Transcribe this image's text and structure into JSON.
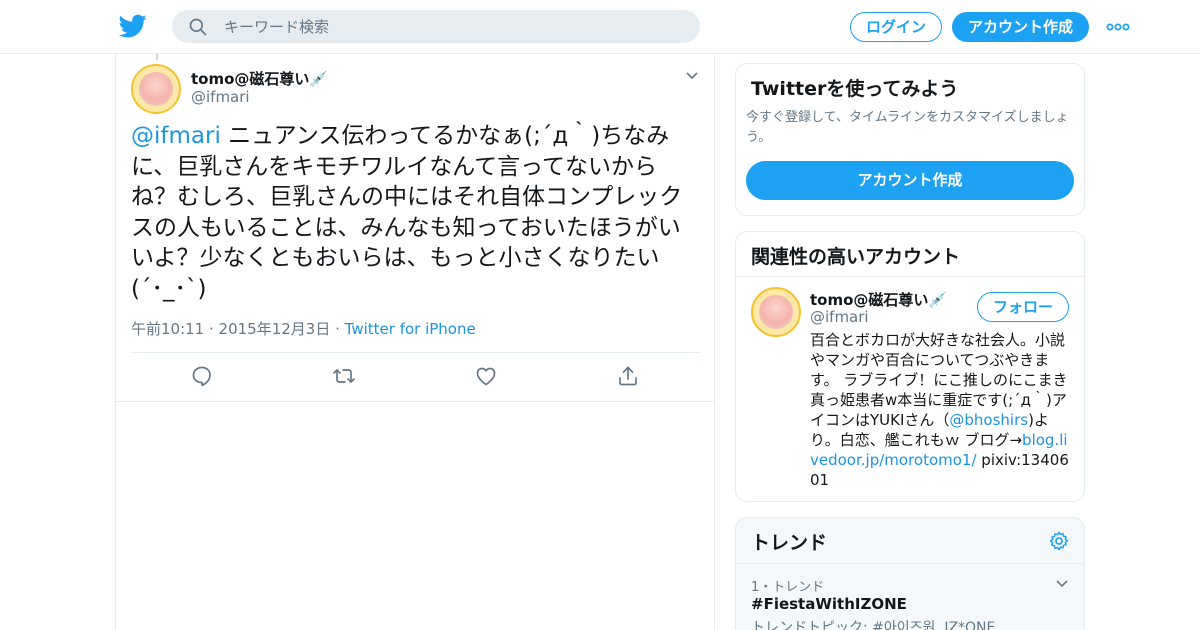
{
  "header": {
    "search_placeholder": "キーワード検索",
    "login_label": "ログイン",
    "signup_label": "アカウント作成",
    "brand_color": "#1da1f2"
  },
  "tweet": {
    "author_name": "tomo@磁石尊い💉",
    "author_handle": "@ifmari",
    "mention": "@ifmari",
    "text": " ニュアンス伝わってるかなぁ(;´д｀)ちなみに、巨乳さんをキモチワルイなんて言ってないからね？むしろ、巨乳さんの中にはそれ自体コンプレックスの人もいることは、みんなも知っておいたほうがいいよ？少なくともおいらは、もっと小さくなりたい(´･_･`)",
    "timestamp": "午前10:11 · 2015年12月3日",
    "separator": " · ",
    "source": "Twitter for iPhone"
  },
  "signup_card": {
    "title": "Twitterを使ってみよう",
    "description": "今すぐ登録して、タイムラインをカスタマイズしましょう。",
    "button_label": "アカウント作成"
  },
  "related": {
    "title": "関連性の高いアカウント",
    "name": "tomo@磁石尊い💉",
    "handle": "@ifmari",
    "follow_label": "フォロー",
    "bio_part1": "百合とボカロが大好きな社会人。小説やマンガや百合についてつぶやきます。 ラブライブ！にこ推しのにこまき真っ姫患者w本当に重症です(;´д｀)アイコンはYUKIさん（",
    "bio_link1": "@bhoshirs",
    "bio_part2": ")より。白恋、艦これもｗ ブログ→",
    "bio_link2": "blog.livedoor.jp/morotomo1/",
    "bio_part3": " pixiv:1340601"
  },
  "trends": {
    "title": "トレンド",
    "items": [
      {
        "rank": "1・トレンド",
        "tag": "#FiestaWithIZONE",
        "topic": "トレンドトピック: #아이즈원, IZ*ONE"
      }
    ]
  }
}
